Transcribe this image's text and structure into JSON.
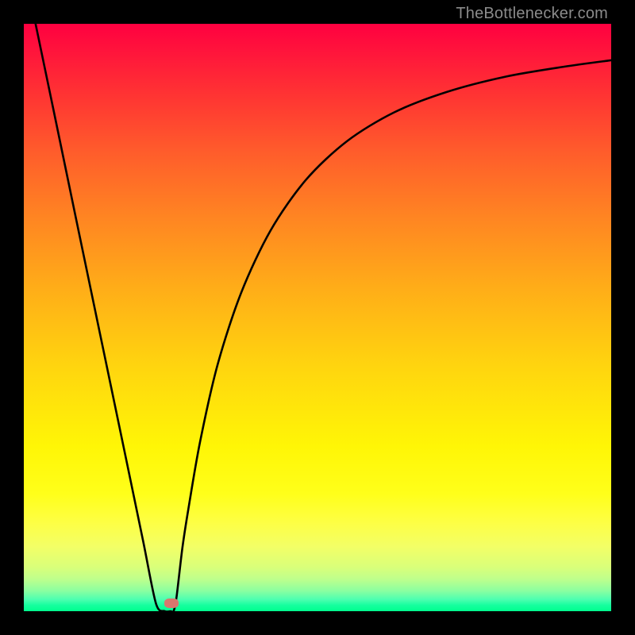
{
  "watermark": "TheBottlenecker.com",
  "chart_data": {
    "type": "line",
    "title": "",
    "xlabel": "",
    "ylabel": "",
    "xlim": [
      0,
      100
    ],
    "ylim": [
      0,
      100
    ],
    "grid": false,
    "series": [
      {
        "name": "curve",
        "x": [
          2,
          5,
          9,
          13,
          17,
          20.3,
          22.5,
          24,
          25,
          25.5,
          26,
          27,
          28,
          30,
          33,
          37,
          42,
          48,
          55,
          63,
          72,
          82,
          92,
          100
        ],
        "y": [
          100,
          85.6,
          66.3,
          47.1,
          27.9,
          12.0,
          1.3,
          0.0,
          0.0,
          0.0,
          2.4,
          10.8,
          17.3,
          28.8,
          42.0,
          54.2,
          64.8,
          73.4,
          80.0,
          84.9,
          88.4,
          91.0,
          92.7,
          93.8
        ]
      }
    ],
    "marker": {
      "x": 25,
      "y": 0,
      "color": "#d8776e"
    },
    "gradient_stops": [
      {
        "pos": 0.0,
        "color": "#ff0040"
      },
      {
        "pos": 0.5,
        "color": "#ffb015"
      },
      {
        "pos": 0.8,
        "color": "#ffff1a"
      },
      {
        "pos": 1.0,
        "color": "#00ff8e"
      }
    ]
  }
}
